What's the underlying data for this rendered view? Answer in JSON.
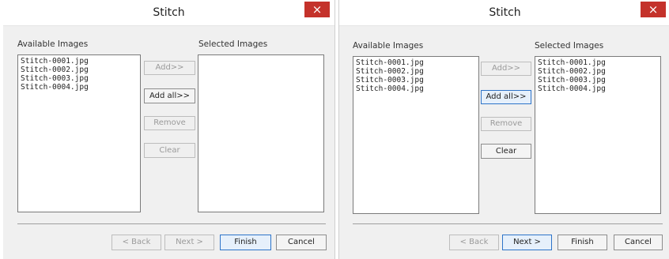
{
  "dialogs": [
    {
      "title": "Stitch",
      "close_glyph": "×",
      "available_label": "Available Images",
      "selected_label": "Selected Images",
      "available_items": [
        "Stitch-0001.jpg",
        "Stitch-0002.jpg",
        "Stitch-0003.jpg",
        "Stitch-0004.jpg"
      ],
      "selected_items": [],
      "buttons": {
        "add": "Add>>",
        "add_all": "Add all>>",
        "remove": "Remove",
        "clear": "Clear",
        "back": "< Back",
        "next": "Next >",
        "finish": "Finish",
        "cancel": "Cancel"
      }
    },
    {
      "title": "Stitch",
      "close_glyph": "×",
      "available_label": "Available Images",
      "selected_label": "Selected Images",
      "available_items": [
        "Stitch-0001.jpg",
        "Stitch-0002.jpg",
        "Stitch-0003.jpg",
        "Stitch-0004.jpg"
      ],
      "selected_items": [
        "Stitch-0001.jpg",
        "Stitch-0002.jpg",
        "Stitch-0003.jpg",
        "Stitch-0004.jpg"
      ],
      "buttons": {
        "add": "Add>>",
        "add_all": "Add all>>",
        "remove": "Remove",
        "clear": "Clear",
        "back": "< Back",
        "next": "Next >",
        "finish": "Finish",
        "cancel": "Cancel"
      }
    }
  ],
  "colors": {
    "close_button": "#c4322b",
    "default_button_border": "#2e74c9"
  }
}
